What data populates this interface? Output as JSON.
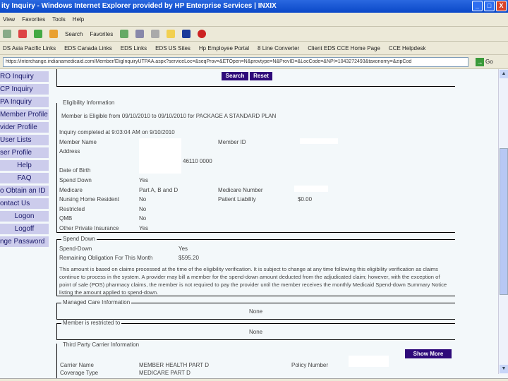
{
  "window": {
    "title": "ity Inquiry - Windows Internet Explorer provided by HP Enterprise Services | INXIX",
    "minimize": "_",
    "maximize": "□",
    "close": "X"
  },
  "menu": [
    "View",
    "Favorites",
    "Tools",
    "Help"
  ],
  "toolbar": {
    "search": "Search",
    "favorites": "Favorites"
  },
  "links": [
    "DS Asia Pacific Links",
    "EDS Canada Links",
    "EDS Links",
    "EDS US Sites",
    "Hp Employee Portal",
    "8 Line Converter",
    "Client EDS CCE Home Page",
    "CCE Helpdesk"
  ],
  "address": {
    "url": "https://interchange.indianamedicaid.com/Member/EligInquiryUTPAA.aspx?serviceLoc=&seqProv=&ETOpen=N&provtype=N&ProvID=&LocCode=&NPI=1043272493&taxonomy=&zipCod",
    "go": "Go"
  },
  "sidebar": [
    "RO Inquiry",
    "CP Inquiry",
    "PA Inquiry",
    "Member Profile",
    "vider Profile",
    "User Lists",
    "ser Profile",
    "Help",
    "FAQ",
    "o Obtain an ID",
    "ontact Us",
    "Logon",
    "Logoff",
    "nge Password"
  ],
  "buttons": {
    "search": "Search",
    "reset": "Reset",
    "show_more": "Show More"
  },
  "eligibility": {
    "legend": "Eligibility Information",
    "eligible_text": "Member is Eligible from 09/10/2010 to 09/10/2010 for PACKAGE A STANDARD PLAN",
    "inquiry_text": "Inquiry completed at 9:03:04 AM on 9/10/2010",
    "member_name_label": "Member Name",
    "member_id_label": "Member ID",
    "address_label": "Address",
    "address_zip": "46110 0000",
    "dob_label": "Date of Birth",
    "spend_down_label": "Spend Down",
    "spend_down": "Yes",
    "medicare_label": "Medicare",
    "medicare": "Part A, B and D",
    "medicare_number_label": "Medicare Number",
    "nursing_label": "Nursing Home Resident",
    "nursing": "No",
    "patient_liability_label": "Patient Liability",
    "patient_liability": "$0.00",
    "restricted_label": "Restricted",
    "restricted": "No",
    "qmb_label": "QMB",
    "qmb": "No",
    "other_ins_label": "Other Private Insurance",
    "other_ins": "Yes"
  },
  "spend_down": {
    "legend": "Spend Down",
    "sd_label": "Spend-Down",
    "sd": "Yes",
    "remaining_label": "Remaining Obligation For This Month",
    "remaining": "$595.20",
    "note": "This amount is based on claims processed at the time of the eligibility verification. It is subject to change at any time following this eligibility verification as claims continue to process in the system. A provider may bill a member for the spend-down amount deducted from the adjudicated claim; however, with the exception of point of sale (POS) pharmacy claims, the member is not required to pay the provider until the member receives the monthly Medicaid Spend-down Summary Notice listing the amount applied to spend-down."
  },
  "managed_care": {
    "legend": "Managed Care Information",
    "value": "None"
  },
  "restricted_to": {
    "legend": "Member is restricted to",
    "value": "None"
  },
  "third_party": {
    "legend": "Third Party Carrier Information",
    "carrier_label": "Carrier Name",
    "carrier": "MEMBER HEALTH PART D",
    "policy_label": "Policy Number",
    "coverage_label": "Coverage Type",
    "coverage": "MEDICARE PART D"
  }
}
